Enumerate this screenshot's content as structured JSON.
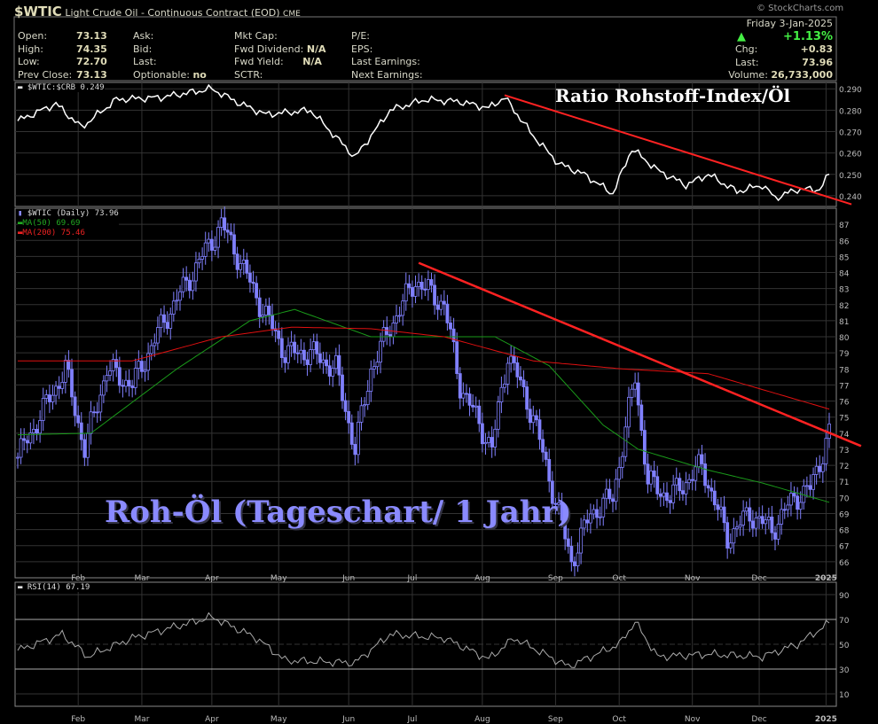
{
  "header": {
    "symbol": "$WTIC",
    "name": "Light Crude Oil - Continuous Contract (EOD)",
    "exchange": "CME",
    "watermark": "© StockCharts.com",
    "open_label": "Open:",
    "open": "73.13",
    "high_label": "High:",
    "high": "74.35",
    "low_label": "Low:",
    "low": "72.70",
    "prev_label": "Prev Close:",
    "prev": "73.13",
    "ask_label": "Ask:",
    "bid_label": "Bid:",
    "last_label": "Last:",
    "optionable_label": "Optionable:",
    "optionable": "no",
    "mktcap_label": "Mkt Cap:",
    "fwddiv_label": "Fwd Dividend:",
    "fwddiv": "N/A",
    "fwdyield_label": "Fwd Yield:",
    "fwdyield": "N/A",
    "sctr_label": "SCTR:",
    "pe_label": "P/E:",
    "eps_label": "EPS:",
    "lastearn_label": "Last Earnings:",
    "nextearn_label": "Next Earnings:",
    "date": "Friday  3-Jan-2025",
    "pct": "+1.13%",
    "chg_label": "Chg:",
    "chg": "+0.83",
    "last2_label": "Last:",
    "last2": "73.96",
    "vol_label": "Volume:",
    "vol": "26,733,000",
    "up_color": "#44ee44"
  },
  "chart_data": [
    {
      "type": "line",
      "title": "Ratio Rohstoff-Index/Öl",
      "legend": "$WTIC:$CRB 0.249",
      "ylim": [
        0.235,
        0.293
      ],
      "yticks": [
        "0.240",
        "0.250",
        "0.260",
        "0.270",
        "0.280",
        "0.290"
      ],
      "points": [
        [
          0,
          0.275
        ],
        [
          12,
          0.283
        ],
        [
          20,
          0.272
        ],
        [
          31,
          0.285
        ],
        [
          45,
          0.286
        ],
        [
          61,
          0.29
        ],
        [
          70,
          0.283
        ],
        [
          78,
          0.278
        ],
        [
          92,
          0.28
        ],
        [
          106,
          0.258
        ],
        [
          117,
          0.28
        ],
        [
          128,
          0.285
        ],
        [
          139,
          0.284
        ],
        [
          148,
          0.281
        ],
        [
          153,
          0.286
        ],
        [
          162,
          0.268
        ],
        [
          170,
          0.255
        ],
        [
          178,
          0.25
        ],
        [
          187,
          0.241
        ],
        [
          193,
          0.262
        ],
        [
          201,
          0.252
        ],
        [
          210,
          0.245
        ],
        [
          217,
          0.25
        ],
        [
          226,
          0.242
        ],
        [
          234,
          0.245
        ],
        [
          238,
          0.239
        ],
        [
          245,
          0.243
        ],
        [
          252,
          0.243
        ],
        [
          255,
          0.25
        ]
      ],
      "trendline": [
        [
          153,
          0.287
        ],
        [
          262,
          0.236
        ]
      ]
    },
    {
      "type": "candlestick",
      "title": "Roh-Öl (Tageschart/ 1 Jahr)",
      "legend": "$WTIC (Daily) 73.96",
      "ma50_legend": "MA(50) 69.69",
      "ma200_legend": "MA(200) 75.46",
      "ylim": [
        65,
        88
      ],
      "yticks": [
        "66",
        "67",
        "68",
        "69",
        "70",
        "71",
        "72",
        "73",
        "74",
        "75",
        "76",
        "77",
        "78",
        "79",
        "80",
        "81",
        "82",
        "83",
        "84",
        "85",
        "86",
        "87"
      ],
      "close": [
        [
          0,
          72.5
        ],
        [
          15,
          78
        ],
        [
          21,
          73
        ],
        [
          28,
          78
        ],
        [
          36,
          77
        ],
        [
          46,
          81
        ],
        [
          58,
          85
        ],
        [
          64,
          87
        ],
        [
          68,
          85.5
        ],
        [
          75,
          82.5
        ],
        [
          84,
          79
        ],
        [
          92,
          79
        ],
        [
          100,
          78
        ],
        [
          106,
          73
        ],
        [
          111,
          78
        ],
        [
          118,
          81
        ],
        [
          125,
          83.5
        ],
        [
          134,
          82
        ],
        [
          139,
          77
        ],
        [
          149,
          73
        ],
        [
          154,
          79
        ],
        [
          162,
          75
        ],
        [
          170,
          69
        ],
        [
          174,
          66
        ],
        [
          180,
          69
        ],
        [
          187,
          70
        ],
        [
          194,
          77.5
        ],
        [
          198,
          71
        ],
        [
          205,
          70
        ],
        [
          215,
          72
        ],
        [
          223,
          67.5
        ],
        [
          230,
          69
        ],
        [
          237,
          68
        ],
        [
          244,
          70
        ],
        [
          249,
          70.5
        ],
        [
          255,
          74
        ]
      ],
      "ma50": [
        [
          0,
          73.9
        ],
        [
          23,
          74
        ],
        [
          50,
          78
        ],
        [
          73,
          81
        ],
        [
          87,
          81.7
        ],
        [
          111,
          80
        ],
        [
          134,
          80
        ],
        [
          150,
          80
        ],
        [
          167,
          78.2
        ],
        [
          184,
          74.5
        ],
        [
          195,
          73
        ],
        [
          217,
          71.7
        ],
        [
          234,
          70.9
        ],
        [
          255,
          69.7
        ]
      ],
      "ma200": [
        [
          0,
          78.5
        ],
        [
          36,
          78.5
        ],
        [
          64,
          80
        ],
        [
          86,
          80.6
        ],
        [
          111,
          80.5
        ],
        [
          134,
          80
        ],
        [
          162,
          78.5
        ],
        [
          190,
          78
        ],
        [
          217,
          77.7
        ],
        [
          255,
          75.5
        ]
      ],
      "trendline": [
        [
          126,
          84.6
        ],
        [
          265,
          73.2
        ]
      ]
    },
    {
      "type": "line",
      "legend": "RSI(14) 67.19",
      "ylim": [
        0,
        100
      ],
      "yticks": [
        "10",
        "30",
        "50",
        "70",
        "90"
      ],
      "points": [
        [
          0,
          45
        ],
        [
          14,
          58
        ],
        [
          22,
          40
        ],
        [
          36,
          55
        ],
        [
          61,
          72
        ],
        [
          75,
          55
        ],
        [
          84,
          37
        ],
        [
          106,
          35
        ],
        [
          117,
          58
        ],
        [
          134,
          55
        ],
        [
          148,
          38
        ],
        [
          156,
          55
        ],
        [
          173,
          32
        ],
        [
          189,
          50
        ],
        [
          194,
          68
        ],
        [
          201,
          40
        ],
        [
          217,
          42
        ],
        [
          234,
          40
        ],
        [
          245,
          50
        ],
        [
          255,
          67
        ]
      ]
    },
    {
      "type": "axis",
      "months": [
        [
          "Feb",
          19
        ],
        [
          "Mar",
          39
        ],
        [
          "Apr",
          61
        ],
        [
          "May",
          82
        ],
        [
          "Jun",
          104
        ],
        [
          "Jul",
          124
        ],
        [
          "Aug",
          146
        ],
        [
          "Sep",
          169
        ],
        [
          "Oct",
          189
        ],
        [
          "Nov",
          212
        ],
        [
          "Dec",
          233
        ],
        [
          "2025",
          254
        ]
      ]
    }
  ]
}
